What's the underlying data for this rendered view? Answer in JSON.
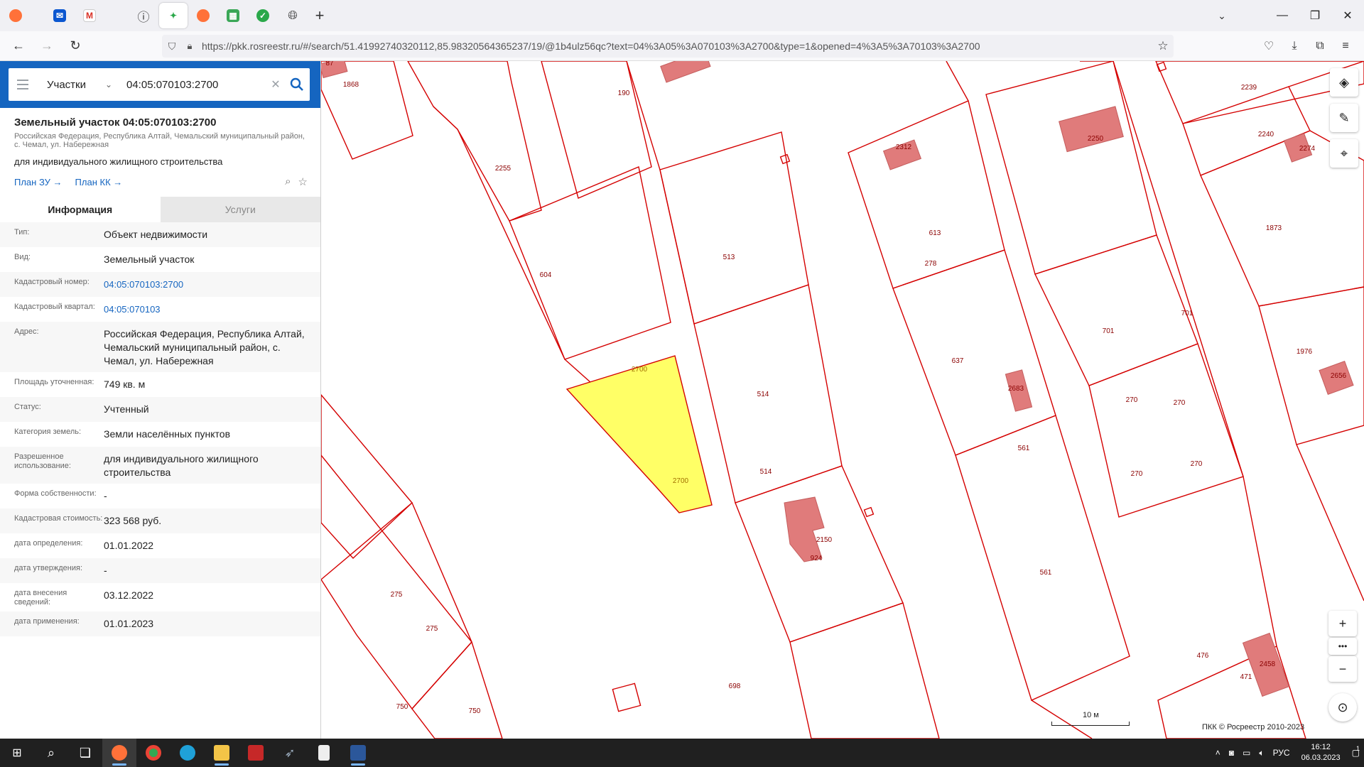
{
  "browser": {
    "url": "https://pkk.rosreestr.ru/#/search/51.41992740320112,85.98320564365237/19/@1b4ulz56qc?text=04%3A05%3A070103%3A2700&type=1&opened=4%3A5%3A70103%3A2700",
    "tabs": [
      {
        "icon": "firefox-icon",
        "active": false
      },
      {
        "icon": "mail-icon",
        "active": false
      },
      {
        "icon": "gmail-icon",
        "active": false
      },
      {
        "icon": "info-icon",
        "active": false
      },
      {
        "icon": "rosreestr-icon",
        "active": true
      },
      {
        "icon": "firefox-icon",
        "active": false
      },
      {
        "icon": "map-icon",
        "active": false
      },
      {
        "icon": "check-icon",
        "active": false
      },
      {
        "icon": "globe-icon",
        "active": false
      }
    ]
  },
  "search": {
    "type": "Участки",
    "query": "04:05:070103:2700"
  },
  "object": {
    "title": "Земельный участок 04:05:070103:2700",
    "address_short": "Российская Федерация, Республика Алтай, Чемальский муниципальный район, с. Чемал, ул. Набережная",
    "use": "для индивидуального жилищного строительства",
    "link_plan_zu": "План ЗУ",
    "link_plan_kk": "План КК"
  },
  "tabs": {
    "info": "Информация",
    "services": "Услуги"
  },
  "rows": [
    {
      "label": "Тип:",
      "value": "Объект недвижимости",
      "link": false
    },
    {
      "label": "Вид:",
      "value": "Земельный участок",
      "link": false
    },
    {
      "label": "Кадастровый номер:",
      "value": "04:05:070103:2700",
      "link": true
    },
    {
      "label": "Кадастровый квартал:",
      "value": "04:05:070103",
      "link": true
    },
    {
      "label": "Адрес:",
      "value": "Российская Федерация, Республика Алтай, Чемальский муниципальный район, с. Чемал, ул. Набережная",
      "link": false
    },
    {
      "label": "Площадь уточненная:",
      "value": "749 кв. м",
      "link": false
    },
    {
      "label": "Статус:",
      "value": "Учтенный",
      "link": false
    },
    {
      "label": "Категория земель:",
      "value": "Земли населённых пунктов",
      "link": false
    },
    {
      "label": "Разрешенное использование:",
      "value": "для индивидуального жилищного строительства",
      "link": false
    },
    {
      "label": "Форма собственности:",
      "value": "-",
      "link": false
    },
    {
      "label": "Кадастровая стоимость:",
      "value": "323 568 руб.",
      "link": false
    },
    {
      "label": "дата определения:",
      "value": "01.01.2022",
      "link": false
    },
    {
      "label": "дата утверждения:",
      "value": "-",
      "link": false
    },
    {
      "label": "дата внесения сведений:",
      "value": "03.12.2022",
      "link": false
    },
    {
      "label": "дата применения:",
      "value": "01.01.2023",
      "link": false
    }
  ],
  "map": {
    "parcel_color": "#d40000",
    "selected_fill": "#ffff66",
    "building_fill": "#e07b7b",
    "labels": [
      "87",
      "1868",
      "190",
      "2255",
      "604",
      "2700",
      "2700",
      "513",
      "514",
      "514",
      "2150",
      "924",
      "278",
      "2312",
      "613",
      "2250",
      "637",
      "2683",
      "561",
      "561",
      "701",
      "701",
      "270",
      "270",
      "270",
      "270",
      "2239",
      "2240",
      "2274",
      "1873",
      "1976",
      "2656",
      "275",
      "275",
      "750",
      "750",
      "698",
      "476",
      "2458",
      "471"
    ],
    "scale": "10 м",
    "copyright": "ПКК © Росреестр 2010-2023"
  },
  "taskbar": {
    "lang": "РУС",
    "time": "16:12",
    "date": "06.03.2023",
    "notif": "1"
  }
}
